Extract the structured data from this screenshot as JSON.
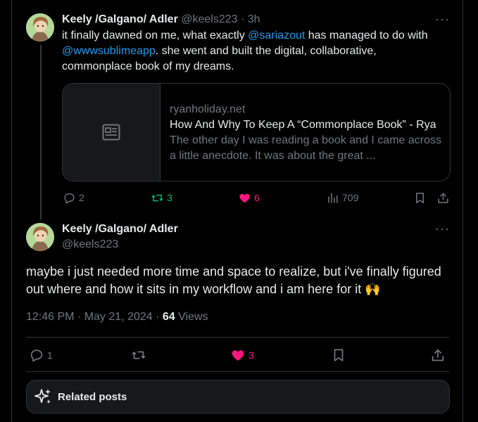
{
  "tweet1": {
    "display_name": "Keely /Galgano/ Adler",
    "handle": "@keels223",
    "separator": "·",
    "time": "3h",
    "text_before": "it finally dawned on me, what exactly ",
    "mention1": "@sariazout",
    "text_middle": " has managed to do with ",
    "mention2": "@wwwsublimeapp",
    "text_after": ". she went and built the digital, collaborative, commonplace book of my dreams.",
    "card": {
      "domain": "ryanholiday.net",
      "title": "How And Why To Keep A “Commonplace Book” - Rya",
      "description": "The other day I was reading a book and I came across a little anecdote. It was about the great ..."
    },
    "actions": {
      "replies": "2",
      "reposts": "3",
      "likes": "6",
      "views": "709"
    }
  },
  "tweet2": {
    "display_name": "Keely /Galgano/ Adler",
    "handle": "@keels223",
    "text": "maybe i just needed more time and space to realize, but i've finally figured out where and how it sits in my workflow and i am here for it 🙌",
    "time": "12:46 PM · May 21, 2024 · ",
    "views_count": "64",
    "views_label": " Views",
    "actions": {
      "replies": "1",
      "likes": "3"
    }
  },
  "related": {
    "label": "Related posts"
  },
  "colors": {
    "background": "#000000",
    "text": "#e7e9ea",
    "muted": "#71767b",
    "link": "#1d9bf0",
    "repost_active": "#00ba7c",
    "like_active": "#f91880",
    "border": "#2f3336"
  }
}
